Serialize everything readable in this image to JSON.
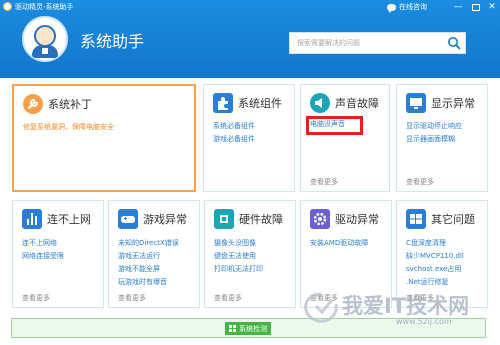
{
  "window": {
    "title": "驱动精灵-系统助手",
    "online_consult": "在线咨询",
    "minimize": "—",
    "close": "✕"
  },
  "brand": {
    "title": "系统助手"
  },
  "search": {
    "placeholder": "搜索需要解决的问题"
  },
  "cards": {
    "system_patch": {
      "title": "系统补丁",
      "links": [
        "修复系统漏洞，保障电脑安全"
      ]
    },
    "system_components": {
      "title": "系统组件",
      "links": [
        "系统必备组件",
        "游戏必备组件"
      ]
    },
    "sound_fault": {
      "title": "声音故障",
      "links": [
        "电脑没声音"
      ],
      "more": "查看更多"
    },
    "display_fault": {
      "title": "显示异常",
      "links": [
        "显示驱动停止响应",
        "显示器画面模糊"
      ],
      "more": "查看更多"
    },
    "no_network": {
      "title": "连不上网",
      "links": [
        "连不上网络",
        "网络连接受限"
      ],
      "more": "查看更多"
    },
    "game_fault": {
      "title": "游戏异常",
      "links": [
        "未知的DirectX错误",
        "游戏无法运行",
        "游戏不能全屏",
        "玩游戏时有爆音"
      ],
      "more": "查看更多"
    },
    "hardware_fault": {
      "title": "硬件故障",
      "links": [
        "摄像头没图像",
        "键盘无法使用",
        "打印机无法打印"
      ],
      "more": "查看更多"
    },
    "driver_fault": {
      "title": "驱动异常",
      "links": [
        "安装AMD驱动故障"
      ],
      "more": "查看更多"
    },
    "other_issues": {
      "title": "其它问题",
      "links": [
        "C盘深度清理",
        "缺少MVCP110.dll",
        "svchost.exe占用",
        ".Net运行修复"
      ],
      "more": "查看更多"
    }
  },
  "detect": {
    "label": "系统检测"
  },
  "watermark": {
    "text": "我爱IT技术网",
    "url": "www.52ij.com"
  },
  "colors": {
    "header": "#1676cc",
    "accent_orange": "#f5a04a",
    "link_blue": "#2a7fd4",
    "highlight_red": "#e3231b",
    "detect_green": "#45b545"
  }
}
